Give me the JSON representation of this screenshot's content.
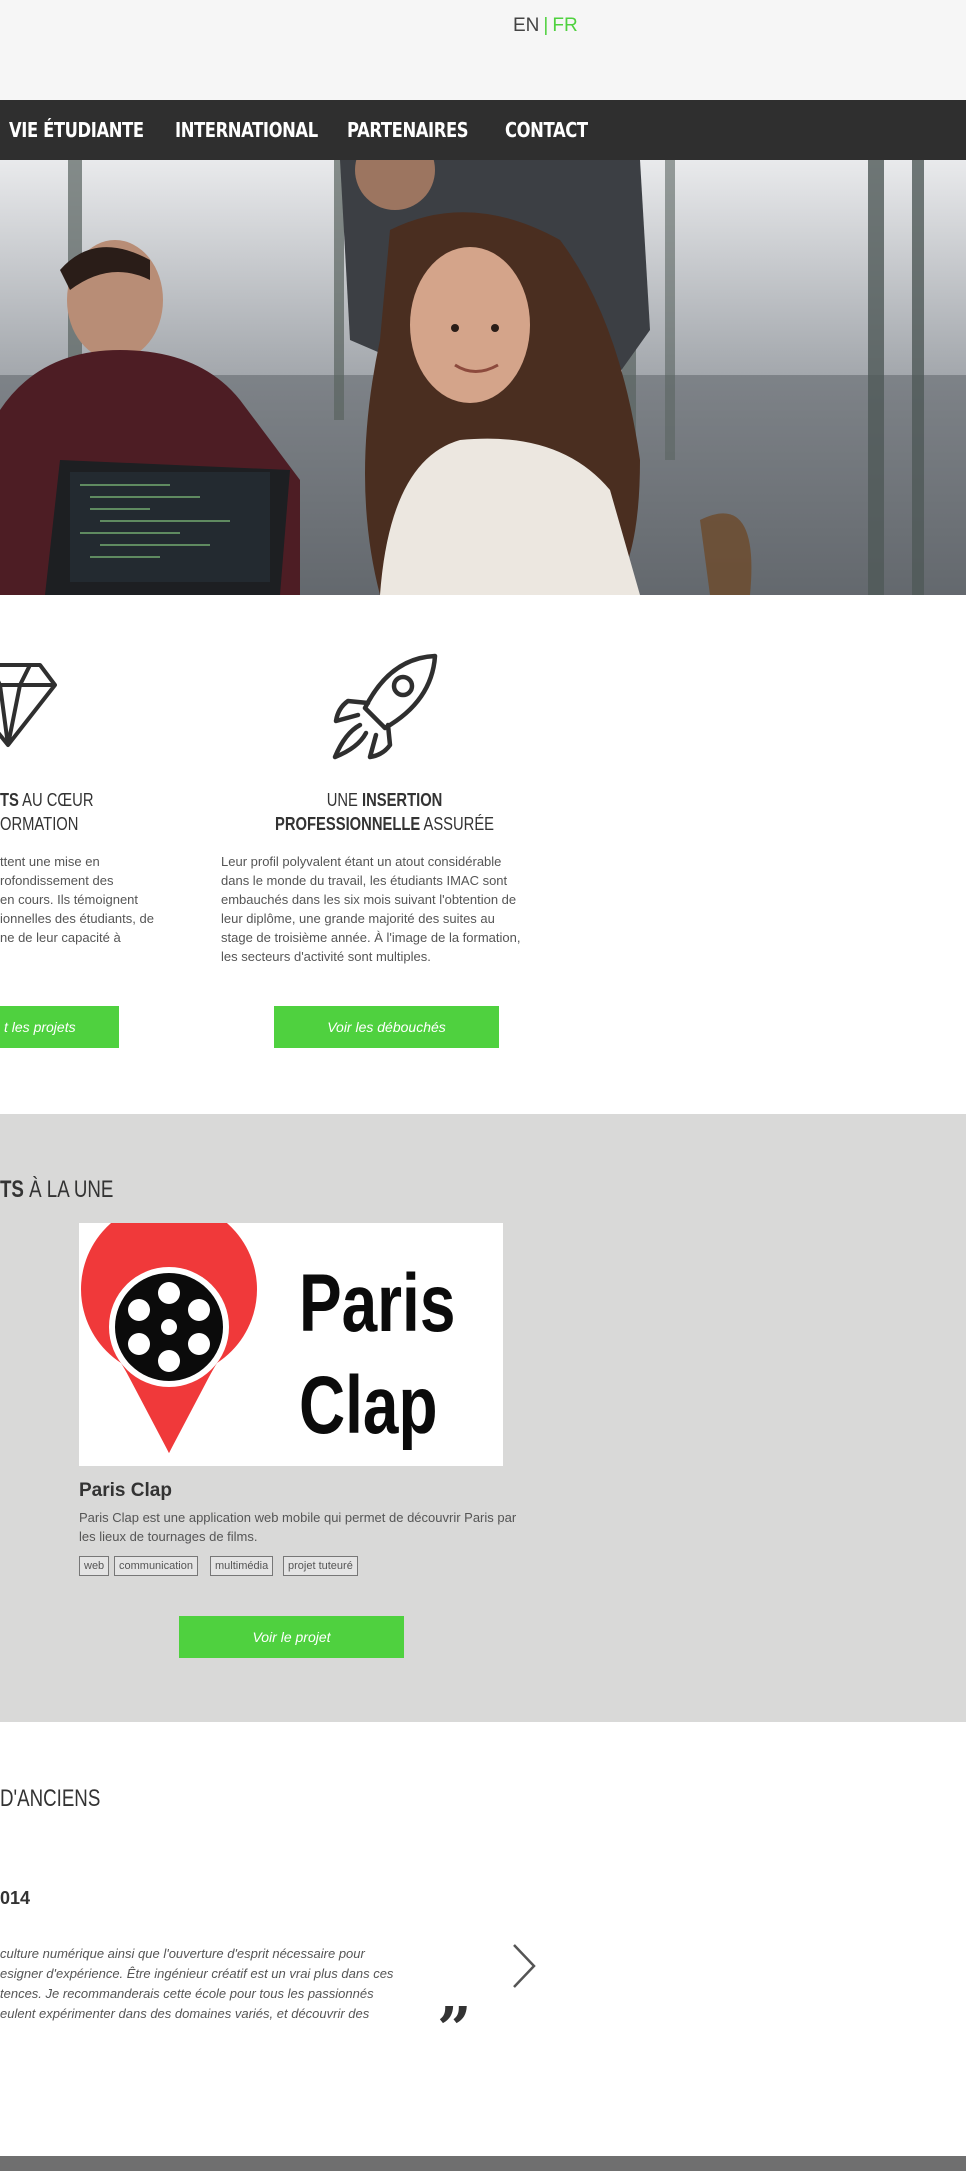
{
  "header": {
    "lang_en": "EN",
    "lang_sep": "|",
    "lang_fr": "FR"
  },
  "nav": {
    "items": [
      {
        "label": "VIE ÉTUDIANTE"
      },
      {
        "label": "INTERNATIONAL"
      },
      {
        "label": "PARTENAIRES"
      },
      {
        "label": "CONTACT"
      }
    ]
  },
  "features": {
    "left": {
      "title_line1_bold": "TS",
      "title_line1_rest": " AU CŒUR",
      "title_line2": "ORMATION",
      "text_lines": [
        "ttent une mise en",
        "rofondissement des",
        "en cours. Ils témoignent",
        "ionnelles des étudiants, de",
        "ne de leur capacité à"
      ],
      "button": "t les projets",
      "icon": "diamond-icon"
    },
    "right": {
      "title_line1_light": "UNE ",
      "title_line1_bold": "INSERTION",
      "title_line2_bold": "PROFESSIONNELLE",
      "title_line2_light": " ASSURÉE",
      "text_lines": [
        "Leur profil polyvalent étant un atout considérable",
        "dans le monde du travail, les étudiants IMAC sont",
        "embauchés dans les six mois suivant l'obtention de",
        "leur diplôme, une grande majorité des suites au",
        "stage de troisième année. À l'image de la formation,",
        "les secteurs d'activité sont multiples."
      ],
      "button": "Voir les débouchés",
      "icon": "rocket-icon"
    }
  },
  "featured": {
    "heading_bold": "TS",
    "heading_rest": " À LA UNE",
    "project": {
      "logo_line1": "Paris",
      "logo_line2": "Clap",
      "title": "Paris Clap",
      "description": "Paris Clap est une application web mobile qui permet de découvrir Paris par les lieux de tournages de films.",
      "tags": [
        "web",
        "communication",
        "multimédia",
        "projet tuteuré"
      ],
      "button": "Voir le projet"
    }
  },
  "testimonials": {
    "heading": " D'ANCIENS",
    "year": "014",
    "quote_lines": [
      "culture numérique ainsi que l'ouverture d'esprit nécessaire pour",
      "esigner d'expérience. Être ingénieur créatif est un vrai plus dans ces",
      "tences. Je recommanderais cette école pour tous les passionnés",
      "eulent expérimenter dans des domaines variés, et découvrir des"
    ],
    "quote_mark": "”"
  },
  "colors": {
    "accent_green": "#4fd13f",
    "nav_bg": "#2f2f2f",
    "grey_section": "#d9d9d8",
    "paris_clap_red": "#f0393a"
  }
}
